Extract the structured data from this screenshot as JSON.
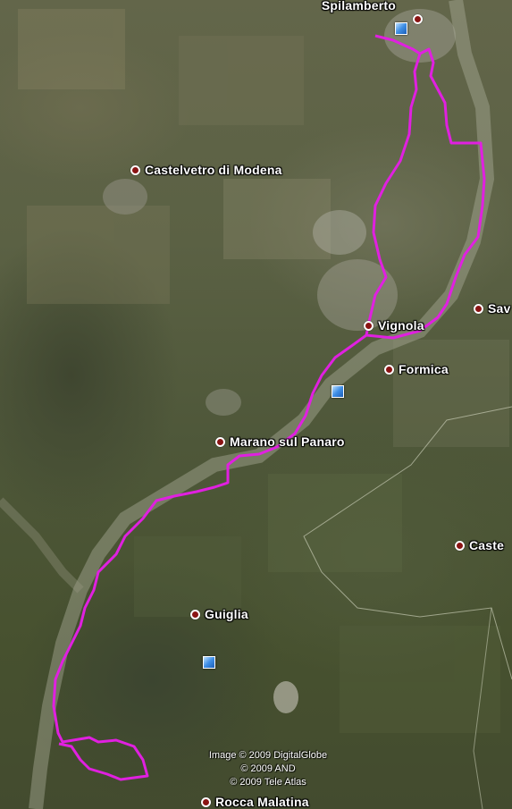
{
  "map": {
    "places": [
      {
        "id": "spilamberto",
        "name": "Spilamberto"
      },
      {
        "id": "castelvetro",
        "name": "Castelvetro di Modena"
      },
      {
        "id": "vignola",
        "name": "Vignola"
      },
      {
        "id": "savignano",
        "name": "Sav"
      },
      {
        "id": "formica",
        "name": "Formica"
      },
      {
        "id": "marano",
        "name": "Marano sul Panaro"
      },
      {
        "id": "castellino",
        "name": "Caste"
      },
      {
        "id": "guiglia",
        "name": "Guiglia"
      },
      {
        "id": "rocca",
        "name": "Rocca Malatina"
      }
    ],
    "route_color": "#e020e0",
    "pin_color": "#3f8fe6",
    "copyright": [
      "Image © 2009 DigitalGlobe",
      "© 2009 AND",
      "© 2009 Tele Atlas"
    ]
  }
}
